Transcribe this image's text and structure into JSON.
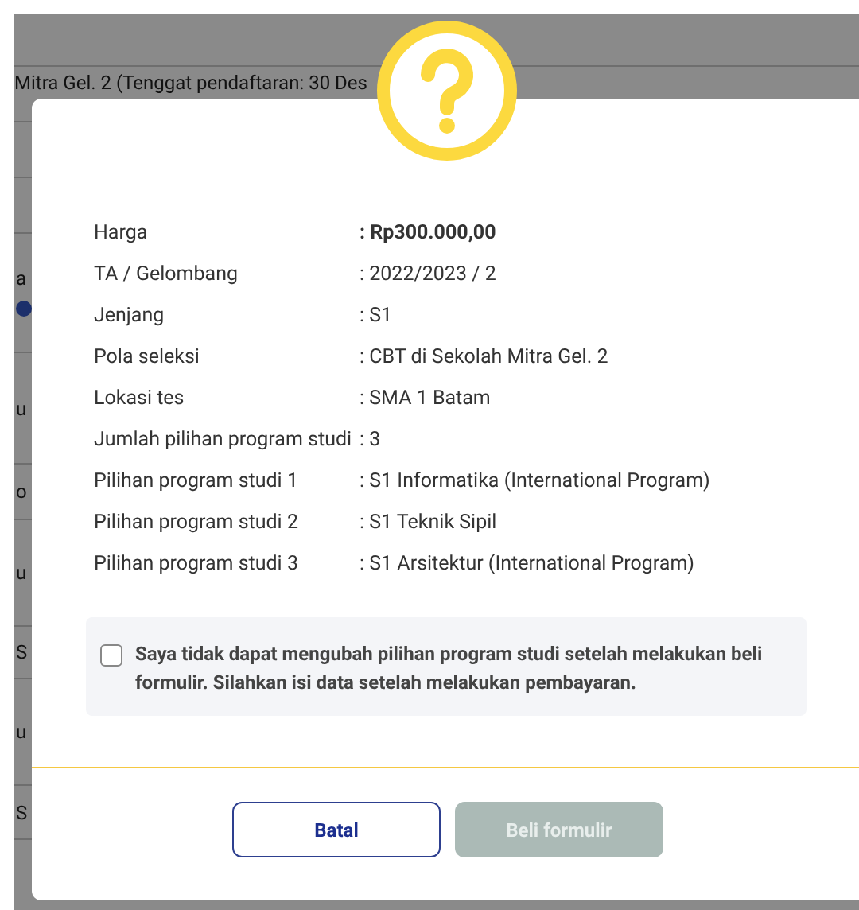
{
  "background_page": {
    "header_text": "Mitra Gel. 2 (Tenggat pendaftaran: 30 Des",
    "rows": [
      {
        "text": "a",
        "radio_selected": true
      },
      {
        "text": "u"
      },
      {
        "text": "o"
      },
      {
        "text": "u"
      },
      {
        "text": "S"
      },
      {
        "text": "u"
      },
      {
        "text": "S"
      }
    ]
  },
  "dialog": {
    "details": [
      {
        "label": "Harga",
        "value": ": Rp300.000,00",
        "emphasis": true
      },
      {
        "label": "TA / Gelombang",
        "value": ": 2022/2023 / 2",
        "emphasis": false
      },
      {
        "label": "Jenjang",
        "value": ": S1",
        "emphasis": false
      },
      {
        "label": "Pola seleksi",
        "value": ": CBT di Sekolah Mitra Gel. 2",
        "emphasis": false
      },
      {
        "label": "Lokasi tes",
        "value": ": SMA 1 Batam",
        "emphasis": false
      },
      {
        "label": "Jumlah pilihan program studi",
        "value": ": 3",
        "emphasis": false
      },
      {
        "label": "Pilihan program studi 1",
        "value": ": S1 Informatika (International Program)",
        "emphasis": false
      },
      {
        "label": "Pilihan program studi 2",
        "value": ": S1 Teknik Sipil",
        "emphasis": false
      },
      {
        "label": "Pilihan program studi 3",
        "value": ": S1 Arsitektur (International Program)",
        "emphasis": false
      }
    ],
    "agreement": {
      "checked": false,
      "text": "Saya tidak dapat mengubah pilihan program studi setelah melakukan beli formulir. Silahkan isi data setelah melakukan pembayaran."
    },
    "buttons": [
      {
        "label": "Batal",
        "kind": "outline",
        "disabled": false
      },
      {
        "label": "Beli formulir",
        "kind": "primary",
        "disabled": true
      }
    ]
  }
}
